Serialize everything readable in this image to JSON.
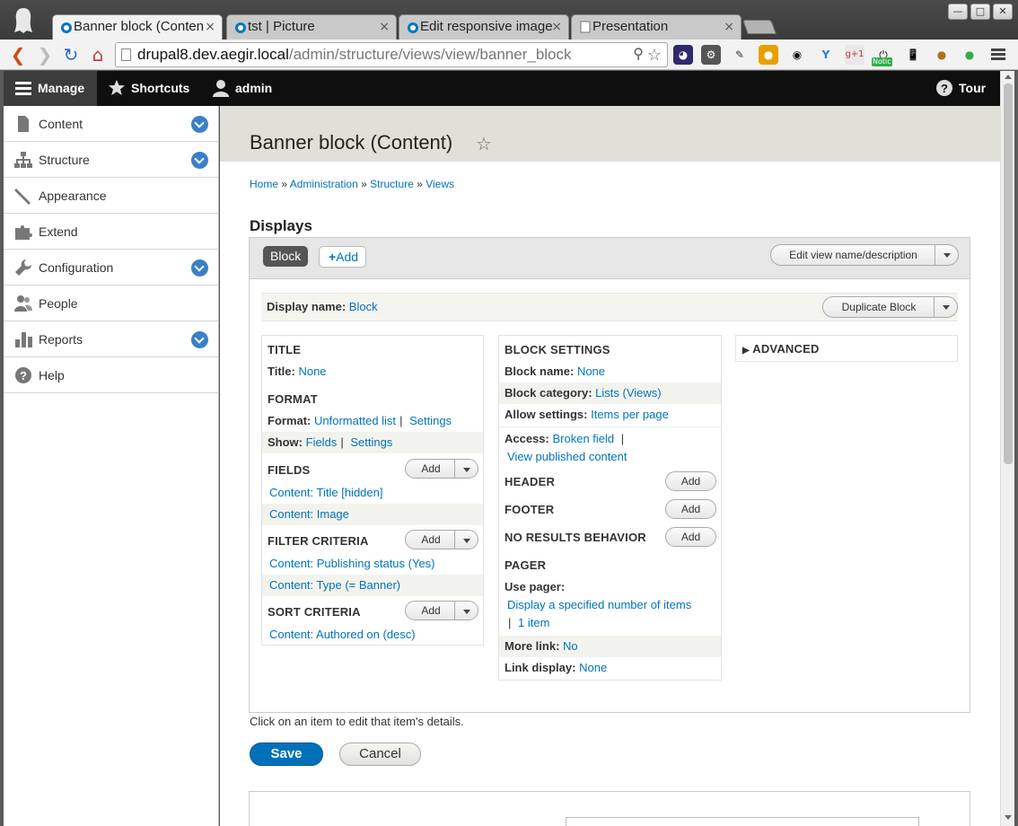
{
  "browser": {
    "tabs": [
      {
        "title": "Banner block (Conten",
        "active": true,
        "icon": "drupal-icon"
      },
      {
        "title": "tst | Picture",
        "active": false,
        "icon": "drupal-icon"
      },
      {
        "title": "Edit responsive image",
        "active": false,
        "icon": "drupal-icon"
      },
      {
        "title": "Presentation",
        "active": false,
        "icon": "page-icon"
      }
    ],
    "close_glyph": "×",
    "url_host": "drupal8.dev.aegir.local",
    "url_path": "/admin/structure/views/view/banner_block",
    "window_buttons": {
      "minimize": "—",
      "maximize": "□",
      "close": "✕"
    },
    "extension_badge": "Notic",
    "gplus_label": "g+1"
  },
  "drupal_toolbar": {
    "manage": "Manage",
    "shortcuts": "Shortcuts",
    "user": "admin",
    "tour": "Tour"
  },
  "sidebar": {
    "items": [
      {
        "label": "Content",
        "icon": "file-icon",
        "expandable": true
      },
      {
        "label": "Structure",
        "icon": "sitemap-icon",
        "expandable": true
      },
      {
        "label": "Appearance",
        "icon": "paintbrush-icon",
        "expandable": false
      },
      {
        "label": "Extend",
        "icon": "puzzle-icon",
        "expandable": false
      },
      {
        "label": "Configuration",
        "icon": "wrench-icon",
        "expandable": true
      },
      {
        "label": "People",
        "icon": "people-icon",
        "expandable": false
      },
      {
        "label": "Reports",
        "icon": "bar-chart-icon",
        "expandable": true
      },
      {
        "label": "Help",
        "icon": "help-icon",
        "expandable": false
      }
    ]
  },
  "page": {
    "title": "Banner block (Content)",
    "breadcrumb": [
      "Home",
      "Administration",
      "Structure",
      "Views"
    ],
    "breadcrumb_sep": "»",
    "displays_heading": "Displays",
    "tab_block": "Block",
    "tab_add": "Add",
    "edit_view_btn": "Edit view name/description",
    "display_name_label": "Display name:",
    "display_name_value": "Block",
    "duplicate_btn": "Duplicate Block",
    "add_label": "Add",
    "pipe": "|",
    "help_text": "Click on an item to edit that item's details.",
    "save": "Save",
    "cancel": "Cancel"
  },
  "left_column": {
    "title_heading": "TITLE",
    "title_label": "Title:",
    "title_value": "None",
    "format_heading": "FORMAT",
    "format_label": "Format:",
    "format_value": "Unformatted list",
    "format_settings": "Settings",
    "show_label": "Show:",
    "show_value": "Fields",
    "show_settings": "Settings",
    "fields_heading": "FIELDS",
    "fields": [
      "Content: Title [hidden]",
      "Content: Image"
    ],
    "filter_heading": "FILTER CRITERIA",
    "filters": [
      "Content: Publishing status (Yes)",
      "Content: Type (= Banner)"
    ],
    "sort_heading": "SORT CRITERIA",
    "sorts": [
      "Content: Authored on (desc)"
    ]
  },
  "middle_column": {
    "block_settings_heading": "BLOCK SETTINGS",
    "block_name_label": "Block name:",
    "block_name_value": "None",
    "block_category_label": "Block category:",
    "block_category_value": "Lists (Views)",
    "allow_settings_label": "Allow settings:",
    "allow_settings_value": "Items per page",
    "access_label": "Access:",
    "access_value": "Broken field",
    "access_value2": "View published content",
    "header_heading": "HEADER",
    "footer_heading": "FOOTER",
    "no_results_heading": "NO RESULTS BEHAVIOR",
    "pager_heading": "PAGER",
    "use_pager_label": "Use pager:",
    "use_pager_value": "Display a specified number of items",
    "use_pager_value2": "1 item",
    "more_link_label": "More link:",
    "more_link_value": "No",
    "link_display_label": "Link display:",
    "link_display_value": "None"
  },
  "right_column": {
    "advanced_heading": "ADVANCED"
  },
  "colors": {
    "link": "#0074bd",
    "save_button": "#0071b8",
    "toggle_blue": "#3b80c6",
    "toolbar_black": "#0f0f0f",
    "header_band": "#e0e0d8"
  }
}
